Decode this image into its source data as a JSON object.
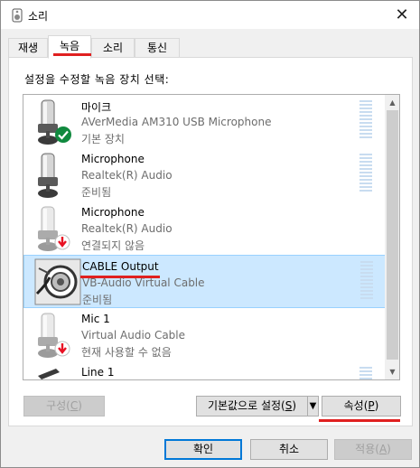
{
  "window": {
    "title": "소리",
    "close_symbol": "✕"
  },
  "tabs": [
    {
      "label": "재생",
      "active": false
    },
    {
      "label": "녹음",
      "active": true
    },
    {
      "label": "소리",
      "active": false
    },
    {
      "label": "통신",
      "active": false
    }
  ],
  "instruction": "설정을 수정할 녹음 장치 선택:",
  "devices": [
    {
      "name": "마이크",
      "description": "AVerMedia AM310 USB Microphone",
      "status": "기본 장치",
      "icon": "microphone-icon",
      "badge": "default-check-badge",
      "selected": false
    },
    {
      "name": "Microphone",
      "description": "Realtek(R) Audio",
      "status": "준비됨",
      "icon": "microphone-icon",
      "badge": "",
      "selected": false
    },
    {
      "name": "Microphone",
      "description": "Realtek(R) Audio",
      "status": "연결되지 않음",
      "icon": "microphone-icon",
      "badge": "disconnected-badge",
      "selected": false
    },
    {
      "name": "CABLE Output",
      "description": "VB-Audio Virtual Cable",
      "status": "준비됨",
      "icon": "cable-icon",
      "badge": "",
      "selected": true
    },
    {
      "name": "Mic 1",
      "description": "Virtual Audio Cable",
      "status": "현재 사용할 수 없음",
      "icon": "microphone-icon",
      "badge": "disconnected-badge",
      "selected": false
    },
    {
      "name": "Line 1",
      "description": "",
      "status": "",
      "icon": "microphone-icon",
      "badge": "",
      "selected": false
    }
  ],
  "buttons": {
    "configure": {
      "label": "구성",
      "mnemonic": "C"
    },
    "set_default": {
      "label": "기본값으로 설정",
      "mnemonic": "S"
    },
    "set_default_arrow": "▼",
    "properties": {
      "label": "속성",
      "mnemonic": "P"
    },
    "ok": "확인",
    "cancel": "취소",
    "apply": {
      "label": "적용",
      "mnemonic": "A"
    }
  },
  "scrollbar": {
    "up": "▲",
    "down": "▼"
  },
  "colors": {
    "selection": "#cce8ff",
    "accent": "#0078d7",
    "annotation_red": "#e02020",
    "check_green": "#10893e",
    "disconnected_red": "#e81123"
  }
}
